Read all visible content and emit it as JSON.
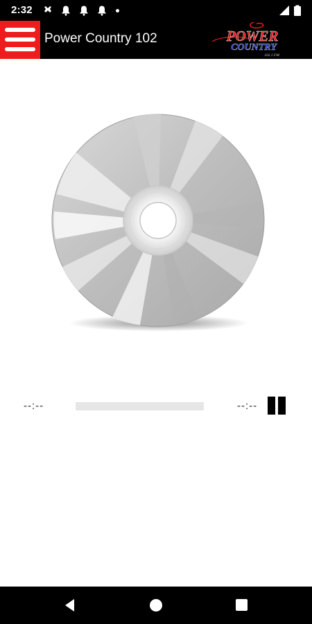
{
  "status_bar": {
    "time": "2:32",
    "icons": [
      "vpn-key-icon",
      "notification-bell-icon",
      "notification-bell-icon",
      "notification-bell-icon",
      "dot-icon",
      "signal-icon",
      "battery-icon"
    ]
  },
  "app_bar": {
    "menu_icon": "hamburger-menu-icon",
    "title": "Power Country 102",
    "logo_text_line1": "POWER",
    "logo_text_line2": "COUNTRY",
    "logo_text_line3": "102.1 FM"
  },
  "album_art": {
    "icon": "compact-disc-icon"
  },
  "player": {
    "time_elapsed": "--:--",
    "time_total": "--:--",
    "progress": 0,
    "pause_icon": "pause-icon"
  },
  "nav_bar": {
    "icons": [
      "back-icon",
      "home-icon",
      "recents-icon"
    ]
  },
  "colors": {
    "app_bar_bg": "#000000",
    "menu_button_bg": "#ee1c1c",
    "logo_red": "#e01818",
    "logo_blue": "#1f33c9",
    "progress_track": "#e6e6e6"
  }
}
